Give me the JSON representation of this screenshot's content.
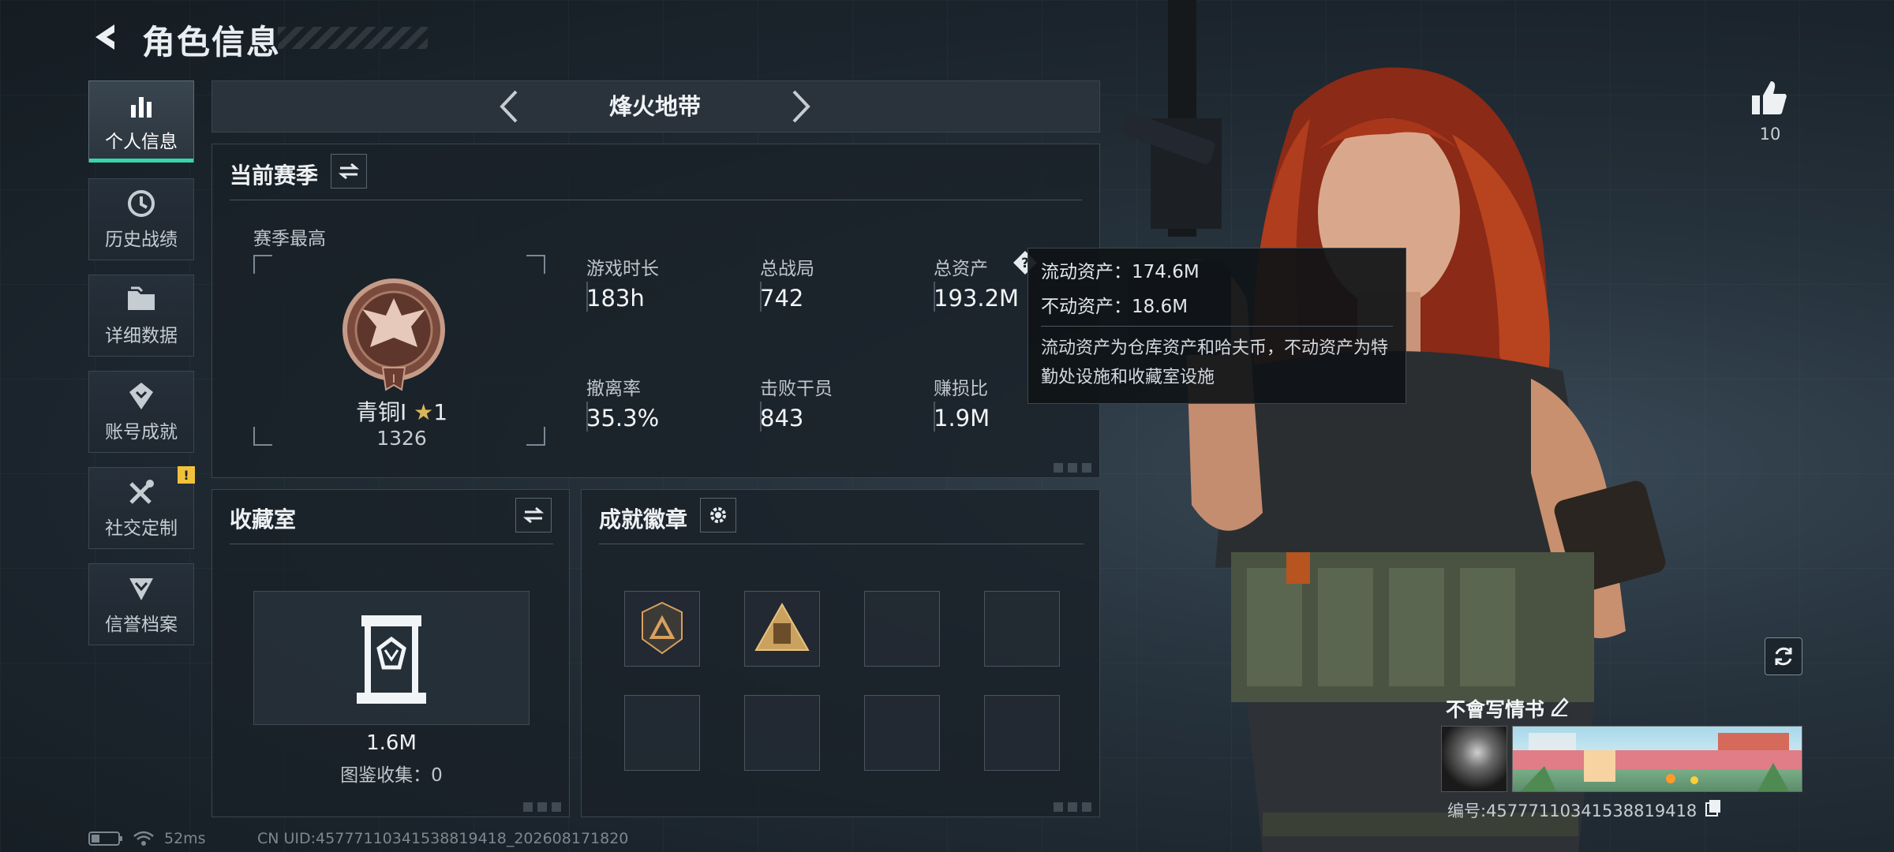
{
  "header": {
    "title": "角色信息"
  },
  "sidebar": {
    "items": [
      {
        "label": "个人信息",
        "icon": "bar-chart-icon",
        "active": true
      },
      {
        "label": "历史战绩",
        "icon": "history-icon"
      },
      {
        "label": "详细数据",
        "icon": "folder-icon"
      },
      {
        "label": "账号成就",
        "icon": "achievement-icon"
      },
      {
        "label": "社交定制",
        "icon": "tools-icon",
        "badge": "!"
      },
      {
        "label": "信誉档案",
        "icon": "shield-icon"
      }
    ]
  },
  "mode": {
    "title": "烽火地带"
  },
  "season": {
    "title": "当前赛季",
    "best_label": "赛季最高",
    "rank_name": "青铜I",
    "rank_stars": "1",
    "rank_score": "1326",
    "stats": [
      {
        "label": "游戏时长",
        "value": "183h"
      },
      {
        "label": "总战局",
        "value": "742"
      },
      {
        "label": "总资产",
        "value": "193.2M"
      },
      {
        "label": "撤离率",
        "value": "35.3%"
      },
      {
        "label": "击败干员",
        "value": "843"
      },
      {
        "label": "赚损比",
        "value": "1.9M"
      }
    ]
  },
  "tooltip": {
    "liquid": "流动资产：174.6M",
    "fixed": "不动资产：18.6M",
    "description": "流动资产为仓库资产和哈夫币，不动资产为特勤处设施和收藏室设施"
  },
  "collection": {
    "title": "收藏室",
    "value": "1.6M",
    "count_text": "图鉴收集：0"
  },
  "badges": {
    "title": "成就徽章",
    "slots": [
      "badge-a",
      "badge-b",
      "",
      "",
      "",
      "",
      "",
      ""
    ]
  },
  "social": {
    "likes": "10"
  },
  "player": {
    "name": "不會写情书",
    "id_text": "编号:457771103415388194​18"
  },
  "status": {
    "ping": "52ms",
    "uid_text": "CN UID:457771103415388194​18_202608171820"
  },
  "colors": {
    "accent": "#37d6a9",
    "warning": "#f0c23b"
  }
}
